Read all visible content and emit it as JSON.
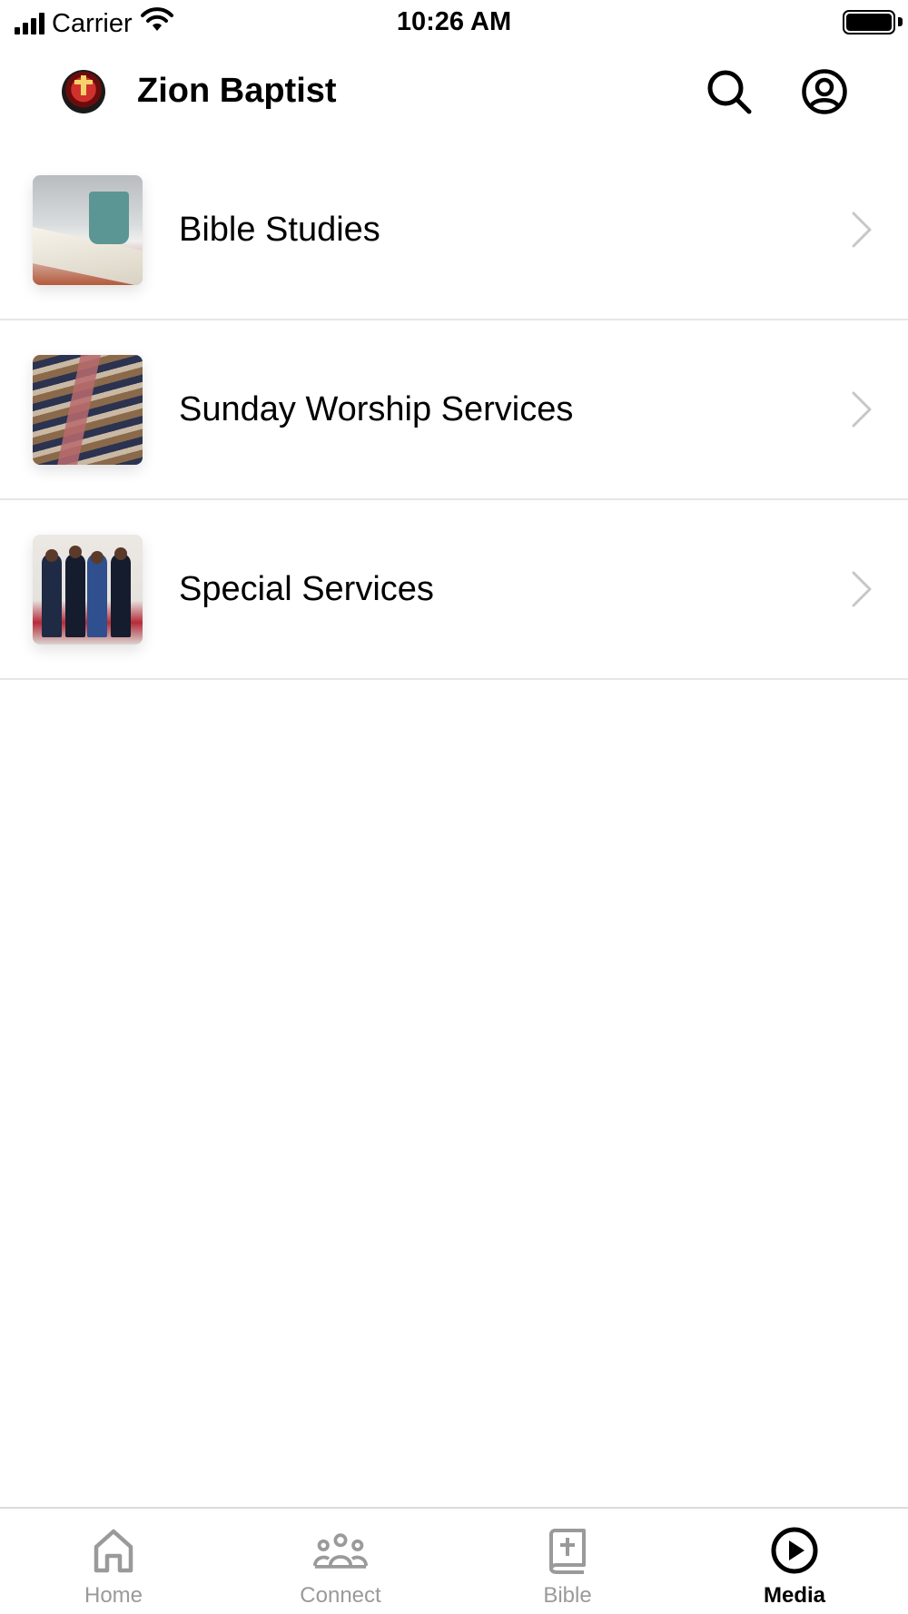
{
  "status_bar": {
    "carrier": "Carrier",
    "time": "10:26 AM",
    "icons": [
      "signal-icon",
      "wifi-icon",
      "battery-icon"
    ]
  },
  "header": {
    "title": "Zion Baptist",
    "icons": [
      "logo-icon",
      "search-icon",
      "account-icon"
    ]
  },
  "list": {
    "items": [
      {
        "label": "Bible Studies",
        "icon": "chevron-right-icon"
      },
      {
        "label": "Sunday Worship Services",
        "icon": "chevron-right-icon"
      },
      {
        "label": "Special Services",
        "icon": "chevron-right-icon"
      }
    ]
  },
  "tab_bar": {
    "tabs": [
      {
        "label": "Home",
        "icon": "home-icon",
        "active": false
      },
      {
        "label": "Connect",
        "icon": "people-icon",
        "active": false
      },
      {
        "label": "Bible",
        "icon": "bible-icon",
        "active": false
      },
      {
        "label": "Media",
        "icon": "play-circle-icon",
        "active": true
      }
    ]
  },
  "colors": {
    "active": "#000000",
    "inactive": "#9a9a9a",
    "chevron": "#c7c7c7",
    "divider": "#e6e6e6"
  }
}
